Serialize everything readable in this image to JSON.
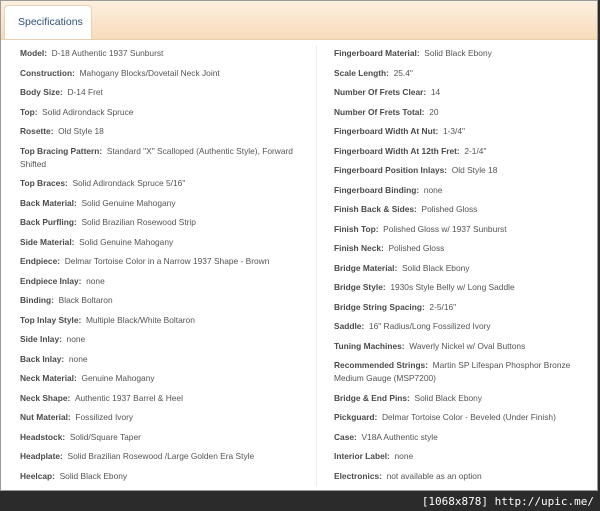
{
  "tab": {
    "label": "Specifications"
  },
  "specs_left": [
    {
      "label": "Model:",
      "value": "D-18 Authentic 1937 Sunburst"
    },
    {
      "label": "Construction:",
      "value": "Mahogany Blocks/Dovetail Neck Joint"
    },
    {
      "label": "Body Size:",
      "value": "D-14 Fret"
    },
    {
      "label": "Top:",
      "value": "Solid Adirondack Spruce"
    },
    {
      "label": "Rosette:",
      "value": "Old Style 18"
    },
    {
      "label": "Top Bracing Pattern:",
      "value": "Standard \"X\" Scalloped (Authentic Style), Forward Shifted"
    },
    {
      "label": "Top Braces:",
      "value": "Solid Adirondack Spruce 5/16\""
    },
    {
      "label": "Back Material:",
      "value": "Solid Genuine Mahogany"
    },
    {
      "label": "Back Purfling:",
      "value": "Solid Brazilian Rosewood Strip"
    },
    {
      "label": "Side Material:",
      "value": "Solid Genuine Mahogany"
    },
    {
      "label": "Endpiece:",
      "value": "Delmar Tortoise Color in a Narrow 1937 Shape - Brown"
    },
    {
      "label": "Endpiece Inlay:",
      "value": "none"
    },
    {
      "label": "Binding:",
      "value": "Black Boltaron"
    },
    {
      "label": "Top Inlay Style:",
      "value": "Multiple Black/White Boltaron"
    },
    {
      "label": "Side Inlay:",
      "value": "none"
    },
    {
      "label": "Back Inlay:",
      "value": "none"
    },
    {
      "label": "Neck Material:",
      "value": "Genuine Mahogany"
    },
    {
      "label": "Neck Shape:",
      "value": "Authentic 1937 Barrel & Heel"
    },
    {
      "label": "Nut Material:",
      "value": "Fossilized Ivory"
    },
    {
      "label": "Headstock:",
      "value": "Solid/Square Taper"
    },
    {
      "label": "Headplate:",
      "value": "Solid Brazilian Rosewood /Large Golden Era Style"
    },
    {
      "label": "Heelcap:",
      "value": "Solid Black Ebony"
    }
  ],
  "specs_right": [
    {
      "label": "Fingerboard Material:",
      "value": "Solid Black Ebony"
    },
    {
      "label": "Scale Length:",
      "value": "25.4\""
    },
    {
      "label": "Number Of Frets Clear:",
      "value": "14"
    },
    {
      "label": "Number Of Frets Total:",
      "value": "20"
    },
    {
      "label": "Fingerboard Width At Nut:",
      "value": "1-3/4\""
    },
    {
      "label": "Fingerboard Width At 12th Fret:",
      "value": "2-1/4\""
    },
    {
      "label": "Fingerboard Position Inlays:",
      "value": "Old Style 18"
    },
    {
      "label": "Fingerboard Binding:",
      "value": "none"
    },
    {
      "label": "Finish Back & Sides:",
      "value": "Polished Gloss"
    },
    {
      "label": "Finish Top:",
      "value": "Polished Gloss w/ 1937 Sunburst"
    },
    {
      "label": "Finish Neck:",
      "value": "Polished Gloss"
    },
    {
      "label": "Bridge Material:",
      "value": "Solid Black Ebony"
    },
    {
      "label": "Bridge Style:",
      "value": "1930s Style Belly w/ Long Saddle"
    },
    {
      "label": "Bridge String Spacing:",
      "value": "2-5/16\""
    },
    {
      "label": "Saddle:",
      "value": "16\" Radius/Long Fossilized Ivory"
    },
    {
      "label": "Tuning Machines:",
      "value": "Waverly Nickel w/ Oval Buttons"
    },
    {
      "label": "Recommended Strings:",
      "value": "Martin SP Lifespan Phosphor Bronze Medium Gauge (MSP7200)"
    },
    {
      "label": "Bridge & End Pins:",
      "value": "Solid Black Ebony"
    },
    {
      "label": "Pickguard:",
      "value": "Delmar Tortoise Color - Beveled (Under Finish)"
    },
    {
      "label": "Case:",
      "value": "V18A Authentic style"
    },
    {
      "label": "Interior Label:",
      "value": "none"
    },
    {
      "label": "Electronics:",
      "value": "not available as an option"
    }
  ],
  "watermark": "[1068x878] http://upic.me/"
}
